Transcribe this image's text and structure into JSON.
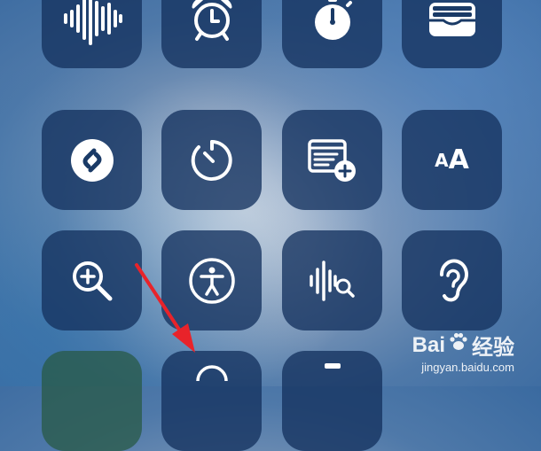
{
  "control_center": {
    "tiles": [
      {
        "name": "Voice Memos",
        "icon": "waveform-icon"
      },
      {
        "name": "Alarm",
        "icon": "alarm-clock-icon"
      },
      {
        "name": "Stopwatch",
        "icon": "stopwatch-icon"
      },
      {
        "name": "Wallet",
        "icon": "wallet-icon"
      },
      {
        "name": "Shazam",
        "icon": "shazam-icon"
      },
      {
        "name": "Timer",
        "icon": "timer-icon"
      },
      {
        "name": "Quick Note",
        "icon": "quick-note-icon"
      },
      {
        "name": "Text Size",
        "icon": "text-size-icon",
        "text_small": "A",
        "text_big": "A"
      },
      {
        "name": "Magnifier",
        "icon": "magnifier-icon"
      },
      {
        "name": "Accessibility Shortcut",
        "icon": "accessibility-icon"
      },
      {
        "name": "Sound Recognition",
        "icon": "sound-recognition-icon"
      },
      {
        "name": "Hearing",
        "icon": "ear-icon"
      },
      {
        "name": "Partial tile",
        "icon": "unknown-icon"
      },
      {
        "name": "Partial tile",
        "icon": "unknown-icon"
      },
      {
        "name": "Partial tile",
        "icon": "unknown-icon"
      }
    ]
  },
  "annotation": {
    "color": "#e8232a",
    "icon": "red-arrow-icon"
  },
  "watermark": {
    "logo_text_1": "Bai",
    "logo_text_2": "经验",
    "url": "jingyan.baidu.com"
  },
  "colors": {
    "tile_bg": "#14325f",
    "icon": "#ffffff"
  }
}
